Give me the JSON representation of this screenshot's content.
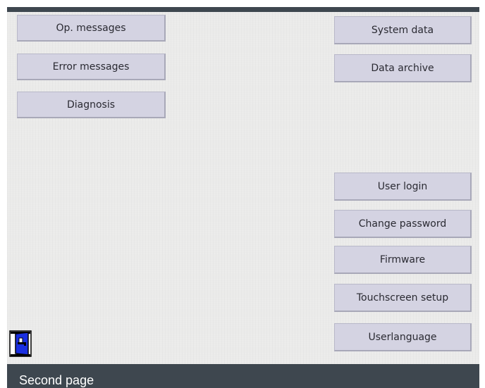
{
  "left_menu": [
    {
      "label": "Op. messages"
    },
    {
      "label": "Error messages"
    },
    {
      "label": "Diagnosis"
    }
  ],
  "right_menu": [
    {
      "label": "System data"
    },
    {
      "label": "Data archive"
    },
    {
      "label": "User login"
    },
    {
      "label": "Change password"
    },
    {
      "label": "Firmware"
    },
    {
      "label": "Touchscreen setup"
    },
    {
      "label": "Userlanguage"
    }
  ],
  "footer": {
    "title": "Second page"
  },
  "icons": {
    "exit": "exit-door-icon"
  },
  "colors": {
    "header_bar": "#3e474f",
    "screen_bg": "#ebebea",
    "button_bg": "#d4d3e2",
    "exit_icon_blue": "#1a2fe0"
  }
}
